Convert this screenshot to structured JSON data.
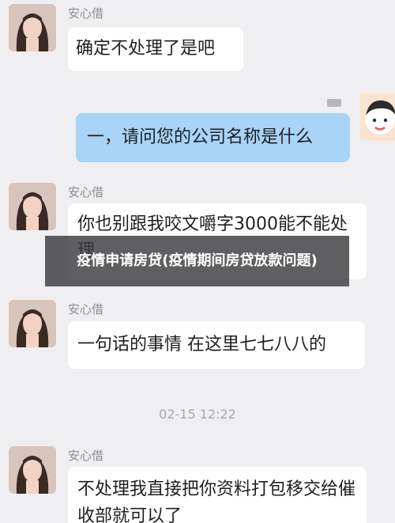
{
  "messages": [
    {
      "sender": "安心借",
      "text": "确定不处理了是吧"
    },
    {
      "text": "一，请问您的公司名称是什么"
    },
    {
      "sender": "安心借",
      "text": "你也别跟我咬文嚼字3000能不能处理"
    },
    {
      "sender": "安心借",
      "text": "一句话的事情 在这里七七八八的"
    },
    {
      "sender": "安心借",
      "text": "不处理我直接把你资料打包移交给催收部就可以了"
    }
  ],
  "timestamp": "02-15 12:22",
  "overlay_caption": "疫情申请房贷(疫情期间房贷放款问题)",
  "colors": {
    "background": "#efeff1",
    "bubble_left": "#ffffff",
    "bubble_right": "#a9d4f7",
    "overlay": "#3c3c40"
  }
}
